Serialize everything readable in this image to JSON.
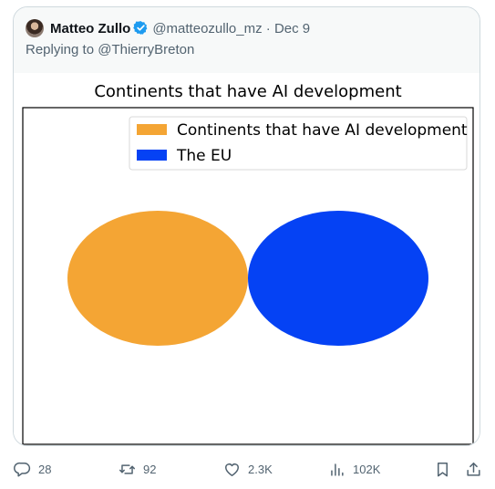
{
  "tweet": {
    "display_name": "Matteo Zullo",
    "handle": "@matteozullo_mz",
    "separator": "·",
    "date": "Dec 9",
    "replying_to_prefix": "Replying to",
    "replying_to_handle": "@ThierryBreton",
    "verified_icon": "verified-badge-icon",
    "accent_color": "#1d9bf0"
  },
  "chart_data": {
    "type": "venn",
    "title": "Continents that have AI development",
    "legend_position": "top-right",
    "sets": [
      {
        "name": "Continents that have AI development",
        "color": "#f4a534"
      },
      {
        "name": "The EU",
        "color": "#0542f4"
      }
    ],
    "overlap": 0
  },
  "actions": {
    "replies": "28",
    "retweets": "92",
    "likes": "2.3K",
    "views": "102K",
    "icons": [
      "reply-icon",
      "retweet-icon",
      "like-icon",
      "views-icon",
      "bookmark-icon",
      "share-icon"
    ]
  }
}
